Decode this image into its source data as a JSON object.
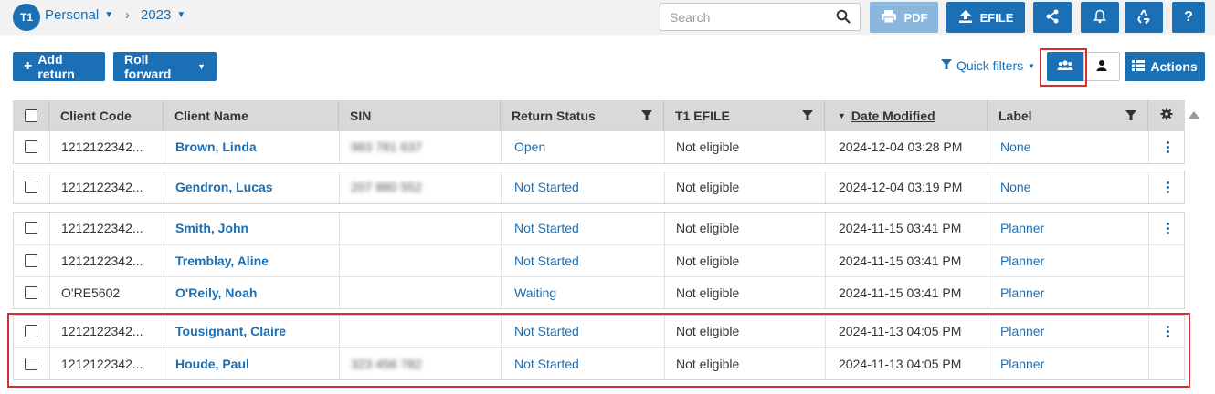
{
  "app": {
    "product_badge": "T1",
    "breadcrumb": {
      "module": "Personal",
      "year": "2023"
    }
  },
  "search": {
    "placeholder": "Search"
  },
  "topbar": {
    "pdf_label": "PDF",
    "efile_label": "EFILE",
    "icons": [
      "print-icon",
      "upload-icon",
      "share-icon",
      "bell-icon",
      "recycle-icon",
      "help-icon"
    ],
    "help_label": "?"
  },
  "toolbar": {
    "add_return_label": "Add return",
    "roll_forward_label": "Roll forward",
    "quick_filters_label": "Quick filters",
    "actions_label": "Actions"
  },
  "table": {
    "columns": {
      "client_code": "Client Code",
      "client_name": "Client Name",
      "sin": "SIN",
      "return_status": "Return Status",
      "t1_efile": "T1 EFILE",
      "date_modified": "Date Modified",
      "label": "Label"
    },
    "sort": {
      "column": "Date Modified",
      "direction": "descending"
    },
    "groups": [
      {
        "rows": [
          {
            "code": "1212122342...",
            "name": "Brown, Linda",
            "sin": "983 781 637",
            "status": "Open",
            "efile": "Not eligible",
            "date": "2024-12-04 03:28 PM",
            "label": "None"
          }
        ]
      },
      {
        "rows": [
          {
            "code": "1212122342...",
            "name": "Gendron, Lucas",
            "sin": "207 880 552",
            "status": "Not Started",
            "efile": "Not eligible",
            "date": "2024-12-04 03:19 PM",
            "label": "None"
          }
        ]
      },
      {
        "rows": [
          {
            "code": "1212122342...",
            "name": "Smith, John",
            "sin": "",
            "status": "Not Started",
            "efile": "Not eligible",
            "date": "2024-11-15 03:41 PM",
            "label": "Planner"
          },
          {
            "code": "1212122342...",
            "name": "Tremblay, Aline",
            "sin": "",
            "status": "Not Started",
            "efile": "Not eligible",
            "date": "2024-11-15 03:41 PM",
            "label": "Planner"
          },
          {
            "code": "O'RE5602",
            "name": "O'Reily, Noah",
            "sin": "",
            "status": "Waiting",
            "efile": "Not eligible",
            "date": "2024-11-15 03:41 PM",
            "label": "Planner"
          }
        ]
      },
      {
        "rows": [
          {
            "code": "1212122342...",
            "name": "Tousignant, Claire",
            "sin": "",
            "status": "Not Started",
            "efile": "Not eligible",
            "date": "2024-11-13 04:05 PM",
            "label": "Planner"
          },
          {
            "code": "1212122342...",
            "name": "Houde, Paul",
            "sin": "323 456 782",
            "status": "Not Started",
            "efile": "Not eligible",
            "date": "2024-11-13 04:05 PM",
            "label": "Planner"
          }
        ]
      }
    ]
  },
  "colors": {
    "accent": "#1a6fb5",
    "highlight": "#d32f2f",
    "header_bg": "#d9d9d9"
  }
}
